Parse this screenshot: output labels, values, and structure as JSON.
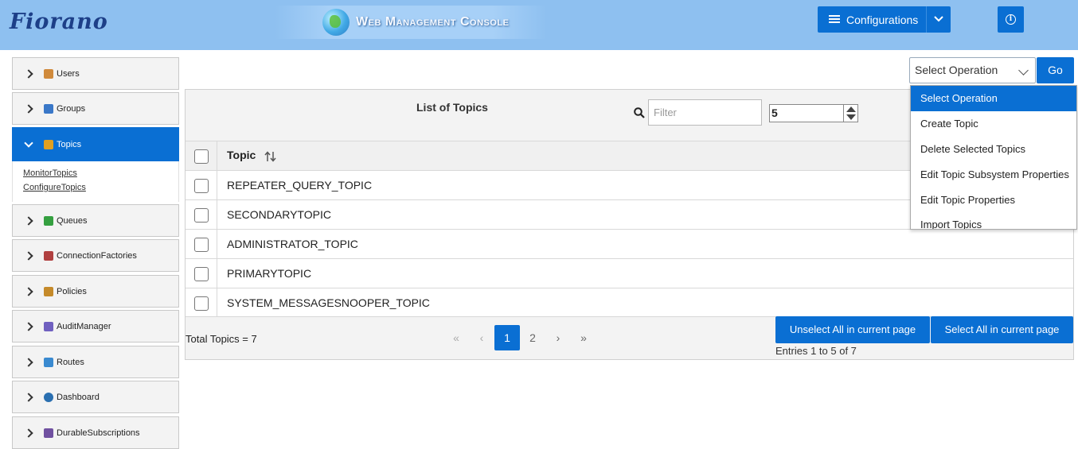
{
  "header": {
    "logo": "Fiorano",
    "banner_title": "Web Management Console",
    "configurations_label": "Configurations",
    "info_icon": "info-icon"
  },
  "sidebar": {
    "items": [
      {
        "label": "Users",
        "icon": "user-icon",
        "color": "#d08a3c"
      },
      {
        "label": "Groups",
        "icon": "group-icon",
        "color": "#3a78c8"
      },
      {
        "label": "Topics",
        "icon": "topics-icon",
        "color": "#e0a020"
      },
      {
        "label": "Queues",
        "icon": "queue-icon",
        "color": "#35a040"
      },
      {
        "label": "ConnectionFactories",
        "icon": "connection-icon",
        "color": "#b04040"
      },
      {
        "label": "Policies",
        "icon": "policy-icon",
        "color": "#c58a2a"
      },
      {
        "label": "AuditManager",
        "icon": "audit-icon",
        "color": "#7060c0"
      },
      {
        "label": "Routes",
        "icon": "routes-icon",
        "color": "#3a8ad0"
      },
      {
        "label": "Dashboard",
        "icon": "dashboard-icon",
        "color": "#2a6fb0"
      },
      {
        "label": "DurableSubscriptions",
        "icon": "subscription-icon",
        "color": "#7050a0"
      }
    ],
    "topics_sublinks": [
      "MonitorTopics",
      "ConfigureTopics"
    ]
  },
  "operation": {
    "selected": "Select Operation",
    "go_label": "Go",
    "options": [
      "Select Operation",
      "Create Topic",
      "Delete Selected Topics",
      "Edit Topic Subsystem Properties",
      "Edit Topic Properties",
      "Import Topics"
    ]
  },
  "table": {
    "title": "List of Topics",
    "filter_placeholder": "Filter",
    "rows_per_page": "5",
    "column_header": "Topic",
    "rows": [
      "REPEATER_QUERY_TOPIC",
      "SECONDARYTOPIC",
      "ADMINISTRATOR_TOPIC",
      "PRIMARYTOPIC",
      "SYSTEM_MESSAGESNOOPER_TOPIC"
    ],
    "total": "Total Topics = 7",
    "pages": [
      "1",
      "2"
    ],
    "current_page": "1",
    "unselect_label": "Unselect All in current page",
    "select_label": "Select All in current page",
    "entries": "Entries 1 to 5 of 7"
  },
  "colors": {
    "header_bg": "#8ec0f0",
    "accent": "#0a6fd3"
  }
}
